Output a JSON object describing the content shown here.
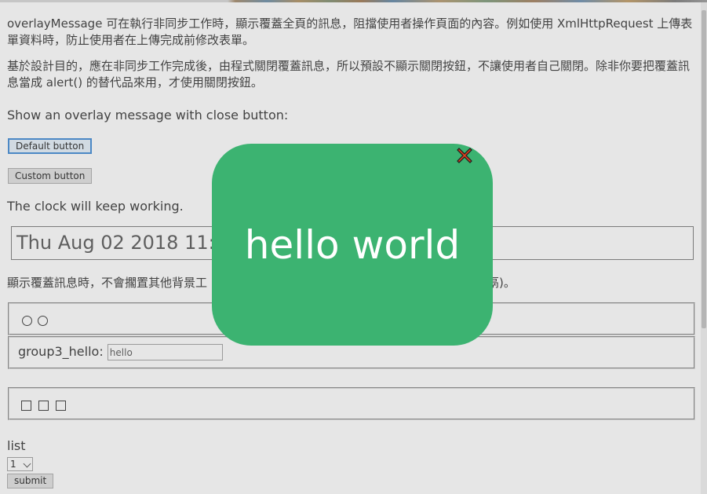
{
  "intro": {
    "paragraph1": "overlayMessage 可在執行非同步工作時，顯示覆蓋全頁的訊息，阻擋使用者操作頁面的內容。例如使用 XmlHttpRequest 上傳表單資料時，防止使用者在上傳完成前修改表單。",
    "paragraph2": "基於設計目的，應在非同步工作完成後，由程式關閉覆蓋訊息，所以預設不顯示關閉按鈕，不讓使用者自己關閉。除非你要把覆蓋訊息當成 alert() 的替代品來用，才使用關閉按鈕。"
  },
  "close_section": {
    "label": "Show an overlay message with close button:",
    "default_button": "Default button",
    "custom_button": "Custom button"
  },
  "clock_section": {
    "label": "The clock will keep working.",
    "clock_value": "Thu Aug 02 2018 11:29"
  },
  "note": {
    "text_left": "顯示覆蓋訊息時，不會擱置其他背景工",
    "text_right": "鬲)。"
  },
  "group3": {
    "label": "group3_hello:",
    "input_value": "hello"
  },
  "list_section": {
    "label": "list",
    "select_value": "1",
    "submit_label": "submit"
  },
  "overlay": {
    "message": "hello world",
    "background_color": "#3cb371",
    "text_color": "#ffffff",
    "close_icon": "close-x-icon"
  }
}
